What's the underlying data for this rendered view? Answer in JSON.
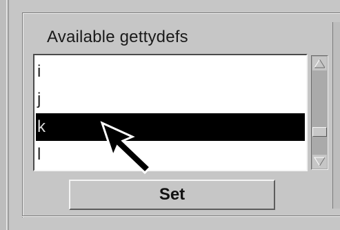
{
  "group": {
    "title": "Available gettydefs"
  },
  "listbox": {
    "items": [
      {
        "label": "i",
        "selected": false
      },
      {
        "label": "j",
        "selected": false
      },
      {
        "label": "k",
        "selected": true
      },
      {
        "label": "l",
        "selected": false
      }
    ]
  },
  "scrollbar": {
    "up_icon": "scroll-up-arrow-icon",
    "down_icon": "scroll-down-arrow-icon"
  },
  "buttons": {
    "set_label": "Set"
  },
  "colors": {
    "background": "#c6c6c6",
    "selection_bg": "#000000",
    "selection_fg": "#d8d8d8"
  }
}
